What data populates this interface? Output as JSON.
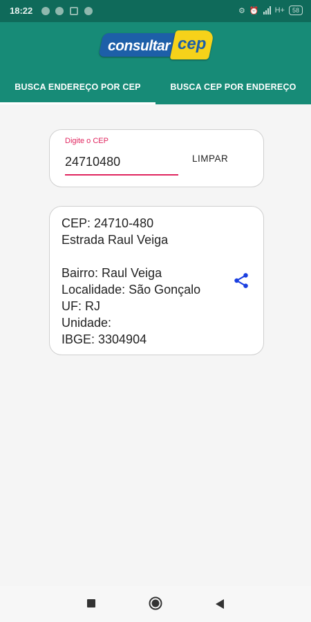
{
  "status_bar": {
    "time": "18:22",
    "network": "H+",
    "battery": "58"
  },
  "logo": {
    "part1": "consultar",
    "part2": "cep"
  },
  "tabs": [
    {
      "label": "BUSCA ENDEREÇO POR CEP",
      "active": true
    },
    {
      "label": "BUSCA CEP POR ENDEREÇO",
      "active": false
    }
  ],
  "search": {
    "label": "Digite o CEP",
    "value": "24710480",
    "clear_label": "LIMPAR"
  },
  "result": {
    "cep": "CEP: 24710-480",
    "street": "Estrada Raul Veiga",
    "bairro": "Bairro: Raul Veiga",
    "localidade": "Localidade: São Gonçalo",
    "uf": "UF: RJ",
    "unidade": "Unidade:",
    "ibge": "IBGE: 3304904"
  },
  "colors": {
    "primary": "#178b77",
    "status": "#0f6a5a",
    "accent": "#e0245e",
    "share": "#1a3fe0"
  }
}
